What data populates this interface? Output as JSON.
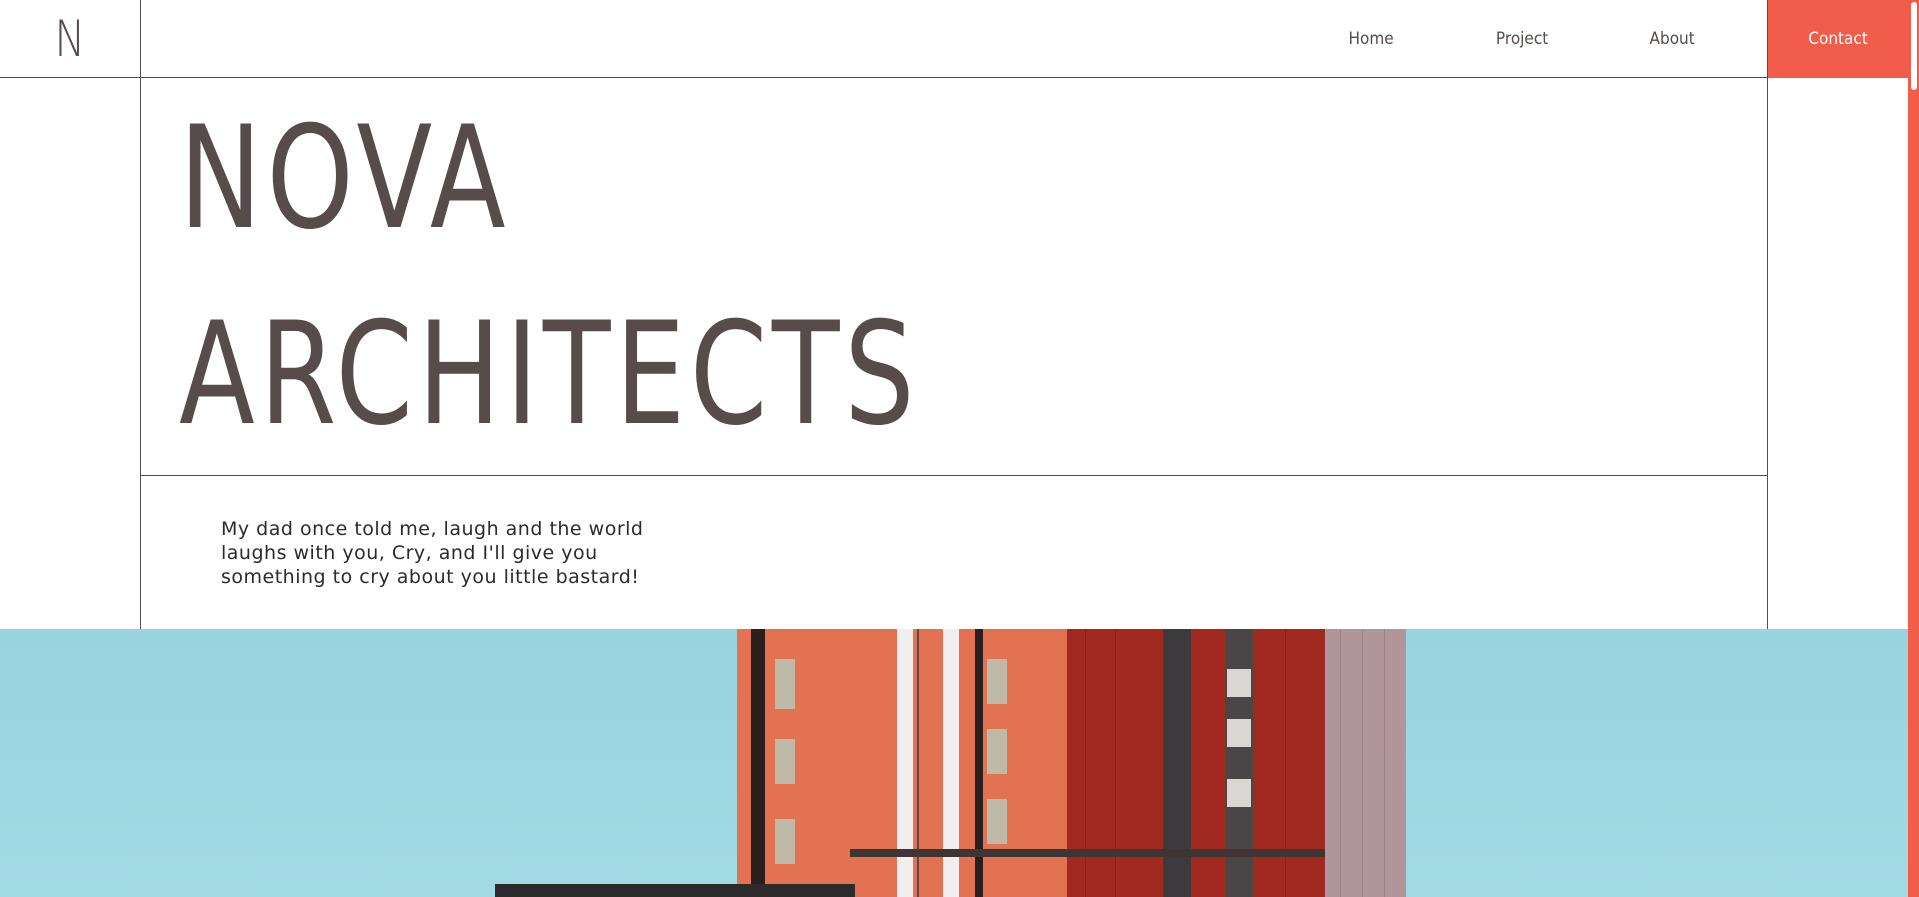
{
  "header": {
    "logo": "N",
    "nav": [
      {
        "label": "Home"
      },
      {
        "label": "Project"
      },
      {
        "label": "About"
      }
    ],
    "contact_label": "Contact"
  },
  "hero": {
    "title_line_1": "NOVA",
    "title_line_2": "ARCHITECTS",
    "quote": "My dad once told me, laugh and the world laughs with you, Cry, and I'll give you something to cry about you little bastard!"
  },
  "colors": {
    "accent": "#f25c4a",
    "text": "#574b4b",
    "sky": "#98d3df",
    "building_orange": "#e27252",
    "building_red": "#a2291f",
    "building_pink": "#b0969b"
  },
  "icons": {
    "hero_image": "building-photo"
  }
}
